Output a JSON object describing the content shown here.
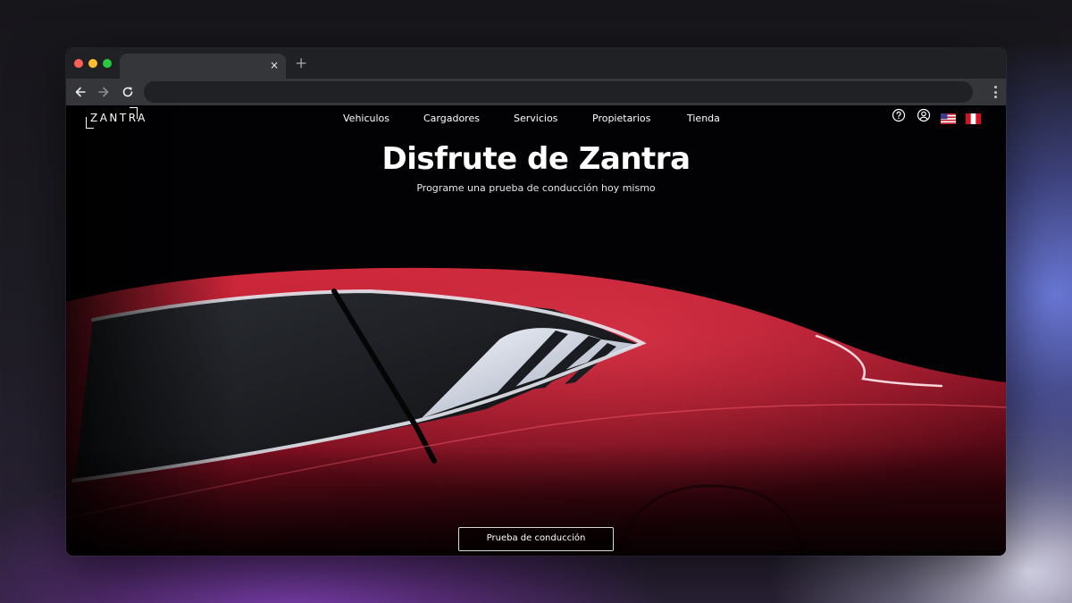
{
  "browser": {
    "tab_title": "",
    "tab_close": "×",
    "new_tab": "+",
    "address": ""
  },
  "site": {
    "logo_text": "ZANTRA",
    "nav": [
      "Vehiculos",
      "Cargadores",
      "Servicios",
      "Propietarios",
      "Tienda"
    ],
    "hero": {
      "title": "Disfrute de Zantra",
      "subtitle": "Programe una prueba de conducción hoy mismo",
      "cta": "Prueba de conducción"
    },
    "icons": [
      "help-icon",
      "account-icon",
      "us-flag-icon",
      "peru-flag-icon"
    ]
  },
  "colors": {
    "car_red": "#b0182a",
    "page_bg": "#020205",
    "chrome_dark": "#202124",
    "chrome_toolbar": "#35363a"
  }
}
